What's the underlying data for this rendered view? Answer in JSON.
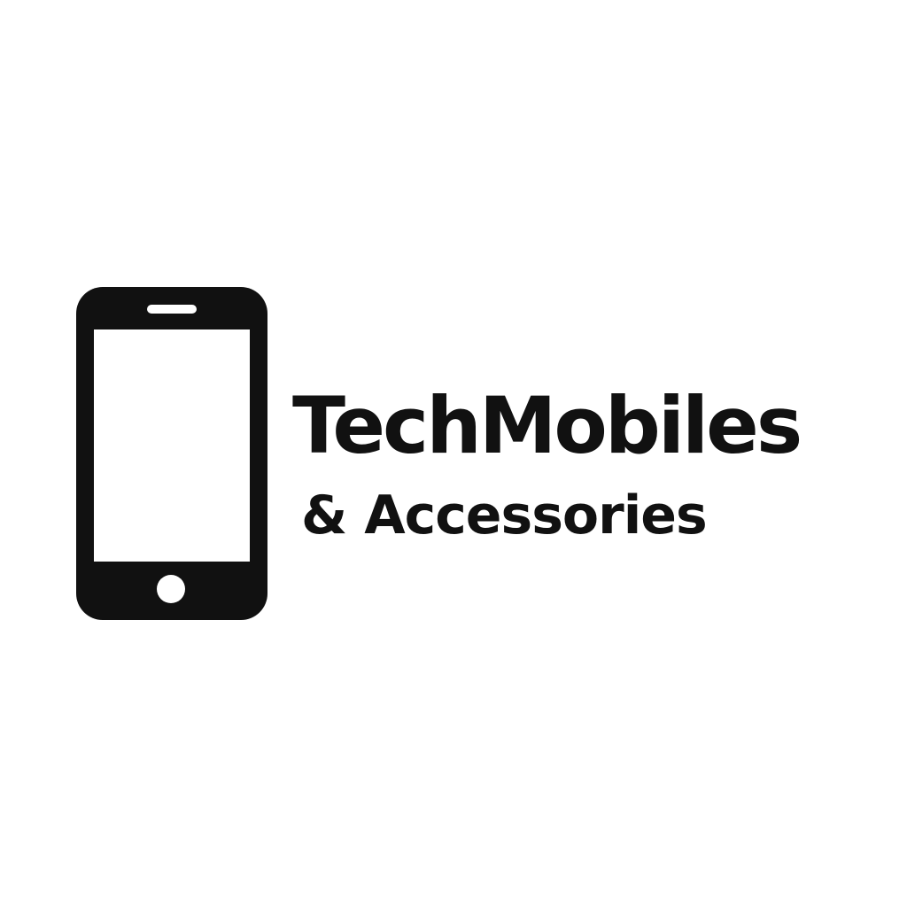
{
  "logo": {
    "icon": "smartphone-icon",
    "brand_name": "TechMobiles",
    "tagline": "& Accessories"
  },
  "colors": {
    "background": "#ffffff",
    "ink": "#111111",
    "screen": "#ffffff"
  }
}
